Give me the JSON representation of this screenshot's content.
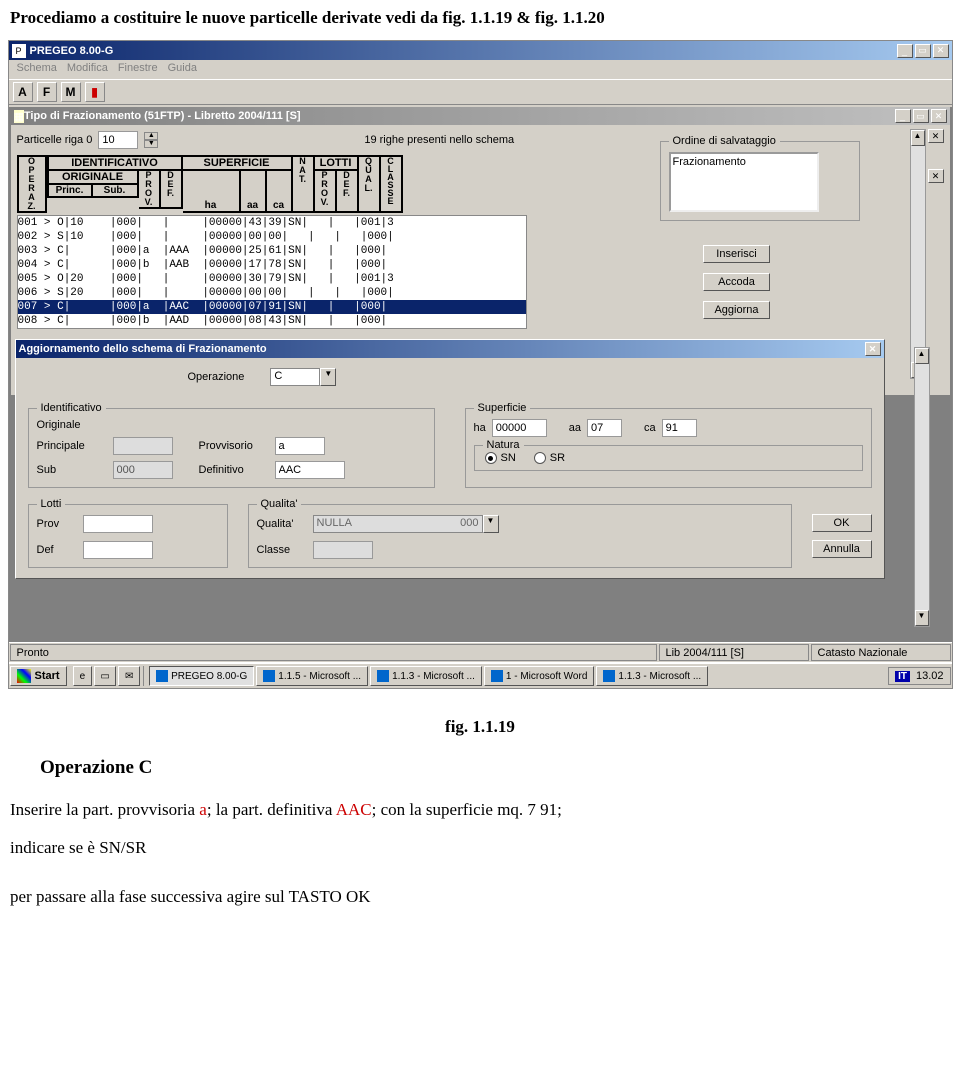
{
  "page_heading": "Procediamo a costituire le nuove particelle derivate vedi da fig. 1.1.19 &  fig. 1.1.20",
  "app": {
    "title": "PREGEO 8.00-G",
    "menu": [
      "Schema",
      "Modifica",
      "Finestre",
      "Guida"
    ],
    "toolbar": [
      "A",
      "F",
      "M"
    ]
  },
  "doc_window": {
    "title": "Tipo di Frazionamento (51FTP) - Libretto 2004/111 [S]",
    "particelle_label": "Particelle riga 0",
    "particelle_value": "10",
    "righe_label": "19 righe presenti nello schema",
    "ordine_label": "Ordine di salvataggio",
    "ordine_value": "Frazionamento",
    "headers": {
      "operaz": "OPERAZ.",
      "identificativo": "IDENTIFICATIVO",
      "originale": "ORIGINALE",
      "princ": "Princ.",
      "sub": "Sub.",
      "prov1": "PROV.",
      "def1": "DEF.",
      "superficie": "SUPERFICIE",
      "ha": "ha",
      "aa": "aa",
      "ca": "ca",
      "nat": "NAT.",
      "lotti": "LOTTI",
      "prov2": "PROV.",
      "def2": "DEF.",
      "qual": "QUAL.",
      "classe": "CLASSE"
    },
    "rows": [
      "001 > O|10    |000|   |     |00000|43|39|SN|   |   |001|3",
      "002 > S|10    |000|   |     |00000|00|00|   |   |   |000|",
      "003 > C|      |000|a  |AAA  |00000|25|61|SN|   |   |000|",
      "004 > C|      |000|b  |AAB  |00000|17|78|SN|   |   |000|",
      "005 > O|20    |000|   |     |00000|30|79|SN|   |   |001|3",
      "006 > S|20    |000|   |     |00000|00|00|   |   |   |000|",
      "007 > C|      |000|a  |AAC  |00000|07|91|SN|   |   |000|",
      "008 > C|      |000|b  |AAD  |00000|08|43|SN|   |   |000|"
    ],
    "selected_row_index": 6,
    "buttons": {
      "inserisci": "Inserisci",
      "accoda": "Accoda",
      "aggiorna": "Aggiorna"
    }
  },
  "dialog": {
    "title": "Aggiornamento dello schema di Frazionamento",
    "operazione_label": "Operazione",
    "operazione_value": "C",
    "identificativo": {
      "legend": "Identificativo",
      "originale_label": "Originale",
      "principale_label": "Principale",
      "principale_value": "",
      "sub_label": "Sub",
      "sub_value": "000",
      "provvisorio_label": "Provvisorio",
      "provvisorio_value": "a",
      "definitivo_label": "Definitivo",
      "definitivo_value": "AAC"
    },
    "superficie": {
      "legend": "Superficie",
      "ha_label": "ha",
      "ha_value": "00000",
      "aa_label": "aa",
      "aa_value": "07",
      "ca_label": "ca",
      "ca_value": "91",
      "natura_legend": "Natura",
      "sn_label": "SN",
      "sr_label": "SR",
      "natura_selected": "SN"
    },
    "lotti": {
      "legend": "Lotti",
      "prov_label": "Prov",
      "prov_value": "",
      "def_label": "Def",
      "def_value": ""
    },
    "qualita": {
      "legend": "Qualita'",
      "label": "Qualita'",
      "value": "NULLA",
      "code": "000",
      "classe_label": "Classe",
      "classe_value": ""
    },
    "buttons": {
      "ok": "OK",
      "annulla": "Annulla"
    }
  },
  "statusbar": {
    "left": "Pronto",
    "mid": "Lib 2004/111 [S]",
    "right": "Catasto Nazionale"
  },
  "taskbar": {
    "start": "Start",
    "tasks": [
      {
        "label": "PREGEO 8.00-G",
        "pressed": true
      },
      {
        "label": "1.1.5 - Microsoft ...",
        "pressed": false
      },
      {
        "label": "1.1.3 - Microsoft ...",
        "pressed": false
      },
      {
        "label": "1 - Microsoft Word",
        "pressed": false
      },
      {
        "label": "1.1.3 - Microsoft ...",
        "pressed": false
      }
    ],
    "lang": "IT",
    "clock": "13.02"
  },
  "caption": "fig. 1.1.19",
  "section_heading": "Operazione C",
  "body_line1_prefix": "Inserire la part. provvisoria ",
  "body_line1_a": "a",
  "body_line1_mid": "; la part. definitiva  ",
  "body_line1_aac": "AAC",
  "body_line1_suf": "; con la superficie mq.  7 91;",
  "body_line2": "indicare se è SN/SR",
  "body_line3": "per passare alla fase successiva agire sul TASTO OK"
}
